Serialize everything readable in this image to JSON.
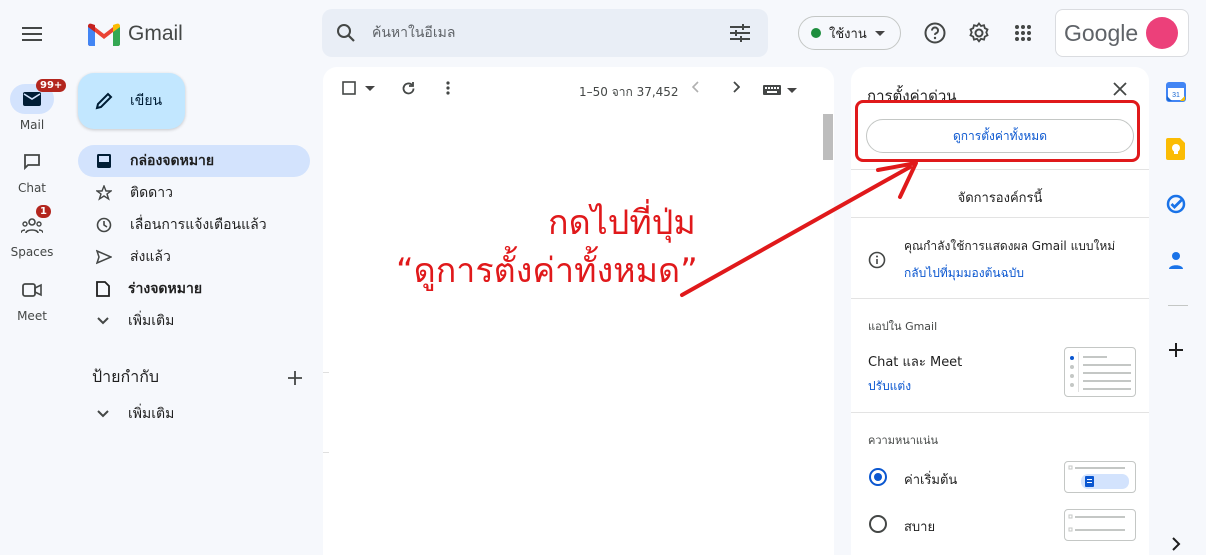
{
  "app": {
    "name": "Gmail"
  },
  "header": {
    "search_placeholder": "ค้นหาในอีเมล",
    "status_label": "ใช้งาน",
    "account_brand": "Google"
  },
  "rail": {
    "mail": {
      "label": "Mail",
      "badge": "99+"
    },
    "chat": {
      "label": "Chat"
    },
    "spaces": {
      "label": "Spaces",
      "badge": "1"
    },
    "meet": {
      "label": "Meet"
    }
  },
  "compose": {
    "label": "เขียน"
  },
  "nav": {
    "inbox": "กล่องจดหมาย",
    "starred": "ติดดาว",
    "snoozed": "เลื่อนการแจ้งเตือนแล้ว",
    "sent": "ส่งแล้ว",
    "drafts": "ร่างจดหมาย",
    "more": "เพิ่มเติม"
  },
  "labels": {
    "title": "ป้ายกำกับ",
    "more": "เพิ่มเติม"
  },
  "mail_list": {
    "count": "1–50 จาก 37,452"
  },
  "quick_settings": {
    "title": "การตั้งค่าด่วน",
    "see_all": "ดูการตั้งค่าทั้งหมด",
    "manage": "จัดการองค์กรนี้",
    "info_text": "คุณกำลังใช้การแสดงผล Gmail แบบใหม่",
    "info_link": "กลับไปที่มุมมองต้นฉบับ",
    "apps_section": "แอปใน Gmail",
    "chat_meet": "Chat และ Meet",
    "customize": "ปรับแต่ง",
    "density_section": "ความหนาแน่น",
    "density_default": "ค่าเริ่มต้น",
    "density_comfortable": "สบาย",
    "density_selected": "default"
  },
  "annotation": {
    "line1": "กดไปที่ปุ่ม",
    "line2": "“ดูการตั้งค่าทั้งหมด”",
    "color": "#e0191b"
  },
  "colors": {
    "accent": "#0b57d0",
    "nav_active": "#d3e3fd",
    "compose_bg": "#c2e7ff",
    "status_green": "#1e8e3e",
    "avatar": "#ec407a"
  }
}
